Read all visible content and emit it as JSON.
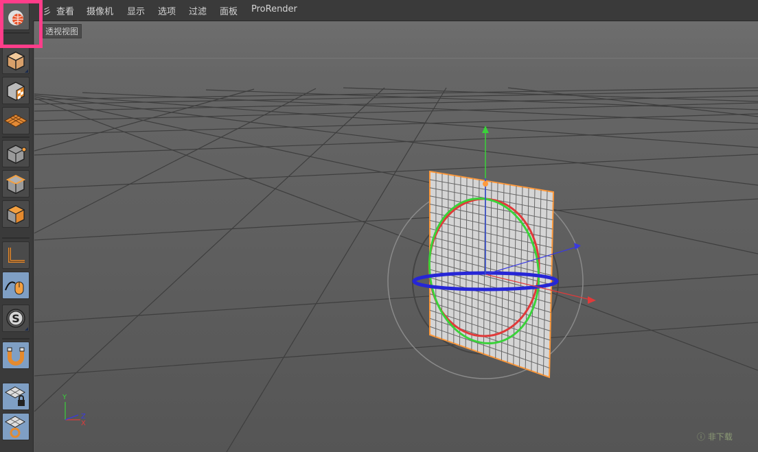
{
  "menu": {
    "items": [
      {
        "id": "edit",
        "label": "彡"
      },
      {
        "id": "view",
        "label": "查看"
      },
      {
        "id": "camera",
        "label": "摄像机"
      },
      {
        "id": "display",
        "label": "显示"
      },
      {
        "id": "options",
        "label": "选项"
      },
      {
        "id": "filter",
        "label": "过滤"
      },
      {
        "id": "panel",
        "label": "面板"
      },
      {
        "id": "prorender",
        "label": "ProRender"
      }
    ]
  },
  "viewport": {
    "label": "透视视图",
    "axis_indicator": {
      "y": "Y",
      "x": "X",
      "z": "Z"
    }
  },
  "toolbar": {
    "tools": [
      {
        "icon": "render-view-icon",
        "state": "active"
      },
      {
        "icon": "model-mode-icon",
        "state": "normal"
      },
      {
        "icon": "texture-mode-icon",
        "state": "normal"
      },
      {
        "icon": "workplane-mode-icon",
        "state": "normal"
      },
      {
        "icon": "points-mode-icon",
        "state": "normal"
      },
      {
        "icon": "edges-mode-icon",
        "state": "normal"
      },
      {
        "icon": "polygons-mode-icon",
        "state": "normal"
      },
      {
        "icon": "axis-mode-icon",
        "state": "normal"
      },
      {
        "icon": "tweak-mode-icon",
        "state": "blue"
      },
      {
        "icon": "snap-icon",
        "state": "normal"
      },
      {
        "icon": "magnet-icon",
        "state": "blue"
      },
      {
        "icon": "lock-workplane-icon",
        "state": "blue"
      },
      {
        "icon": "workplane-planar-icon",
        "state": "blue"
      }
    ]
  },
  "watermark": "ⓘ 非下载",
  "colors": {
    "highlight": "#ff3d8a",
    "selection": "#ff9a3c",
    "axis_x": "#e03a3a",
    "axis_y": "#3ad23a",
    "axis_z": "#3a3ae0"
  }
}
